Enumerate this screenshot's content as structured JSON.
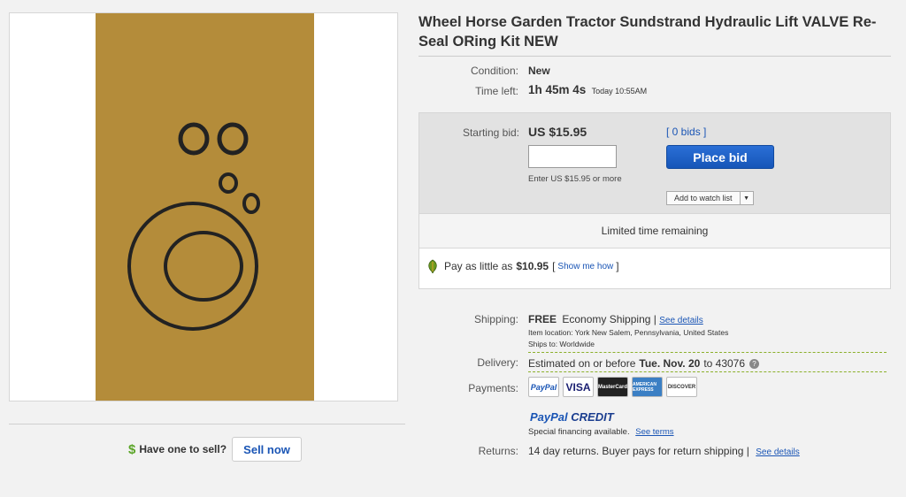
{
  "listing": {
    "title": "Wheel Horse Garden Tractor Sundstrand Hydraulic Lift VALVE Re-Seal ORing Kit NEW"
  },
  "details": {
    "condition_label": "Condition:",
    "condition_value": "New",
    "time_left_label": "Time left:",
    "time_left_value": "1h 45m 4s",
    "time_left_end": "Today 10:55AM"
  },
  "bid": {
    "starting_label": "Starting bid:",
    "starting_value": "US $15.95",
    "bids_link": "[ 0 bids ]",
    "enter_hint": "Enter US $15.95 or more",
    "place_bid": "Place bid",
    "watch_list": "Add to watch list",
    "limited_time": "Limited time remaining",
    "pay_prefix": "Pay as little as",
    "pay_amount": "$10.95",
    "show_me_how": "Show me how"
  },
  "shipping": {
    "label": "Shipping:",
    "free": "FREE",
    "method": "Economy Shipping",
    "see_details": "See details",
    "item_location": "Item location:  York New Salem, Pennsylvania, United States",
    "ships_to": "Ships to:  Worldwide"
  },
  "delivery": {
    "label": "Delivery:",
    "prefix": "Estimated on or before",
    "date": "Tue. Nov. 20",
    "suffix": "to 43076"
  },
  "payments": {
    "label": "Payments:",
    "logos": [
      "PayPal",
      "VISA",
      "MasterCard",
      "AMERICAN EXPRESS",
      "DISCOVER"
    ],
    "paypal_credit_a": "PayPal",
    "paypal_credit_b": "CREDIT",
    "financing": "Special financing available.",
    "see_terms": "See terms"
  },
  "returns": {
    "label": "Returns:",
    "text": "14 day returns. Buyer pays for return shipping |",
    "see_details": "See details"
  },
  "sell": {
    "question": "Have one to sell?",
    "button": "Sell now"
  },
  "colors": {
    "accent_blue": "#1a55b5",
    "place_bid_blue": "#1656b8",
    "photo_background": "#b48c3a",
    "dollar_green": "#5ba528"
  }
}
